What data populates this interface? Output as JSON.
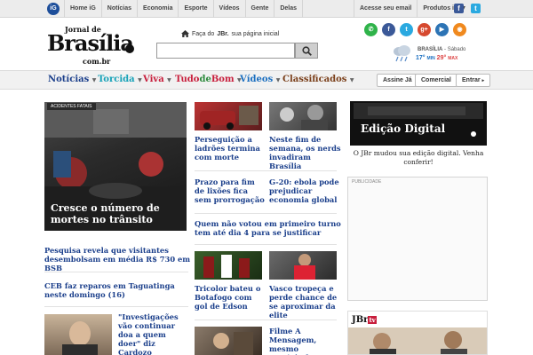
{
  "topbar": {
    "logo_text": "iG",
    "links": [
      "Home iG",
      "Notícias",
      "Economia",
      "Esporte",
      "Vídeos",
      "Gente",
      "Delas"
    ],
    "access_email": "Acesse seu email",
    "produtos": "Produtos iG",
    "facebook": "f",
    "twitter": "t"
  },
  "header": {
    "logo_jornal": "Jornal de",
    "logo_brasilia": "Brasília",
    "logo_combr": "com.br",
    "homepage_prefix": "Faça do",
    "homepage_brand": "JBr.",
    "homepage_suffix": "sua página inicial",
    "search_placeholder": "",
    "weather": {
      "city": "BRASÍLIA",
      "day": "Sábado",
      "min": "17°",
      "min_label": "MIN",
      "max": "29°",
      "max_label": "MAX"
    },
    "social": [
      {
        "icon": "whatsapp-icon",
        "glyph": "✆",
        "color": "#2fb34a"
      },
      {
        "icon": "facebook-icon",
        "glyph": "f",
        "color": "#3b5998"
      },
      {
        "icon": "twitter-icon",
        "glyph": "t",
        "color": "#2aa9e0"
      },
      {
        "icon": "google-plus-icon",
        "glyph": "g+",
        "color": "#d6492f"
      },
      {
        "icon": "youtube-icon",
        "glyph": "▶",
        "color": "#2d74b5"
      },
      {
        "icon": "rss-icon",
        "glyph": "◉",
        "color": "#f0891e"
      }
    ]
  },
  "nav": {
    "items": [
      {
        "label": "Notícias",
        "color": "#1b3f8b"
      },
      {
        "label": "Torcida",
        "color": "#17a2b8"
      },
      {
        "label": "Viva",
        "color": "#c81e3c"
      },
      {
        "label_a": "Tudo",
        "label_b": "de",
        "label_c": "Bom",
        "color_a": "#c81e3c",
        "color_b": "#2c8a3c",
        "color_c": "#c81e3c"
      },
      {
        "label": "Vídeos",
        "color": "#1b6fc0"
      },
      {
        "label": "Classificados",
        "color": "#7a3f1a"
      }
    ],
    "assine": "Assine Já",
    "comercial": "Comercial",
    "entrar": "Entrar"
  },
  "main": {
    "featured_tag": "ACIDENTES FATAIS",
    "featured_caption": "Cresce o número de mortes no trânsito",
    "left_headlines": [
      "Pesquisa revela que visitantes desembolsam em média R$ 730 em BSB",
      "CEB faz reparos em Taguatinga neste domingo (16)"
    ],
    "quote_headline": "\"Investigações vão continuar doa a quem doer\" diz Cardozo",
    "mid_grid": [
      "Perseguição a ladrões termina com morte",
      "Neste fim de semana, os nerds invadiram Brasília",
      "Prazo para fim de lixões fica sem prorrogação",
      "G-20: ebola pode prejudicar economia global"
    ],
    "wide_headline": "Quem não votou em primeiro turno tem até dia 4 para se justificar",
    "sport_grid": [
      "Tricolor bateu o Botafogo com gol de Edson",
      "Vasco tropeça e perde chance de se aproximar da elite"
    ],
    "film_headline": "Filme A Mensagem, mesmo previsível,"
  },
  "sidebar": {
    "edicao_title": "Edição Digital",
    "edicao_text": "O JBr mudou sua edição digital. Venha conferir!",
    "ad_label": "PUBLICIDADE",
    "jbtv_logo": "JBr",
    "jbtv_suffix": "tv"
  },
  "colors": {
    "headline": "#1b3f8b",
    "accent_red": "#c81e3c"
  }
}
